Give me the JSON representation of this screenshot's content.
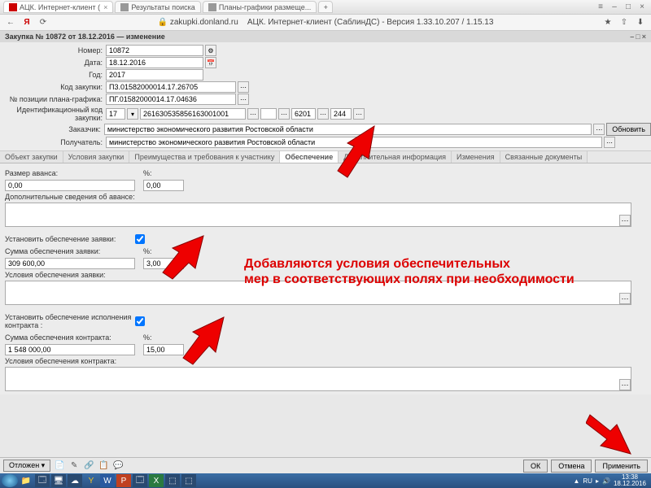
{
  "browser": {
    "tabs": [
      {
        "label": "АЦК. Интернет-клиент (",
        "icon_color": "#c00"
      },
      {
        "label": "Результаты поиска",
        "icon_color": "#888"
      },
      {
        "label": "Планы-графики размеще...",
        "icon_color": "#888"
      }
    ],
    "url_lock": "🔒",
    "url_host": "zakupki.donland.ru",
    "url_title": "АЦК. Интернет-клиент (СаблинДС) - Версия 1.33.10.207 / 1.15.13"
  },
  "window_title": "Закупка № 10872 от 18.12.2016 — изменение",
  "form": {
    "number_label": "Номер:",
    "number_value": "10872",
    "date_label": "Дата:",
    "date_value": "18.12.2016",
    "year_label": "Год:",
    "year_value": "2017",
    "code_label": "Код закупки:",
    "code_value": "П3.01582000014.17.26705",
    "pos_label": "№ позиции плана-графика:",
    "pos_value": "ПГ.01582000014.17.04636",
    "idcode_label": "Идентификационный код закупки:",
    "idcode_y": "17",
    "idcode_num": "261630535856163001001",
    "idcode_seg1": "6201",
    "idcode_seg2": "244",
    "customer_label": "Заказчик:",
    "customer_value": "министерство экономического развития Ростовской области",
    "receiver_label": "Получатель:",
    "receiver_value": "министерство экономического развития Ростовской области",
    "refresh_btn": "Обновить"
  },
  "tabs": [
    "Объект закупки",
    "Условия закупки",
    "Преимущества и требования к участнику",
    "Обеспечение",
    "Дополнительная информация",
    "Изменения",
    "Связанные документы"
  ],
  "tabs_active": 3,
  "content": {
    "advance_size_label": "Размер аванса:",
    "pct_label": "%:",
    "advance_value": "0,00",
    "advance_pct": "0,00",
    "advance_extra_label": "Дополнительные сведения об авансе:",
    "set_app_label": "Установить обеспечение заявки:",
    "app_sum_label": "Сумма обеспечения заявки:",
    "app_sum_value": "309 600,00",
    "app_pct_value": "3,00",
    "app_cond_label": "Условия обеспечения заявки:",
    "set_contract_label": "Установить обеспечение исполнения контракта :",
    "contract_sum_label": "Сумма обеспечения контракта:",
    "contract_sum_value": "1 548 000,00",
    "contract_pct_value": "15,00",
    "contract_cond_label": "Условия обеспечения контракта:"
  },
  "bottom": {
    "left_btn": "Отложен ▾",
    "ok": "ОК",
    "cancel": "Отмена",
    "apply": "Применить"
  },
  "annotation": {
    "line1": "Добавляются условия обеспечительных",
    "line2": "мер в соответствующих полях при необходимости"
  },
  "tray": {
    "lang": "RU",
    "time": "13:38",
    "date": "18.12.2016"
  }
}
